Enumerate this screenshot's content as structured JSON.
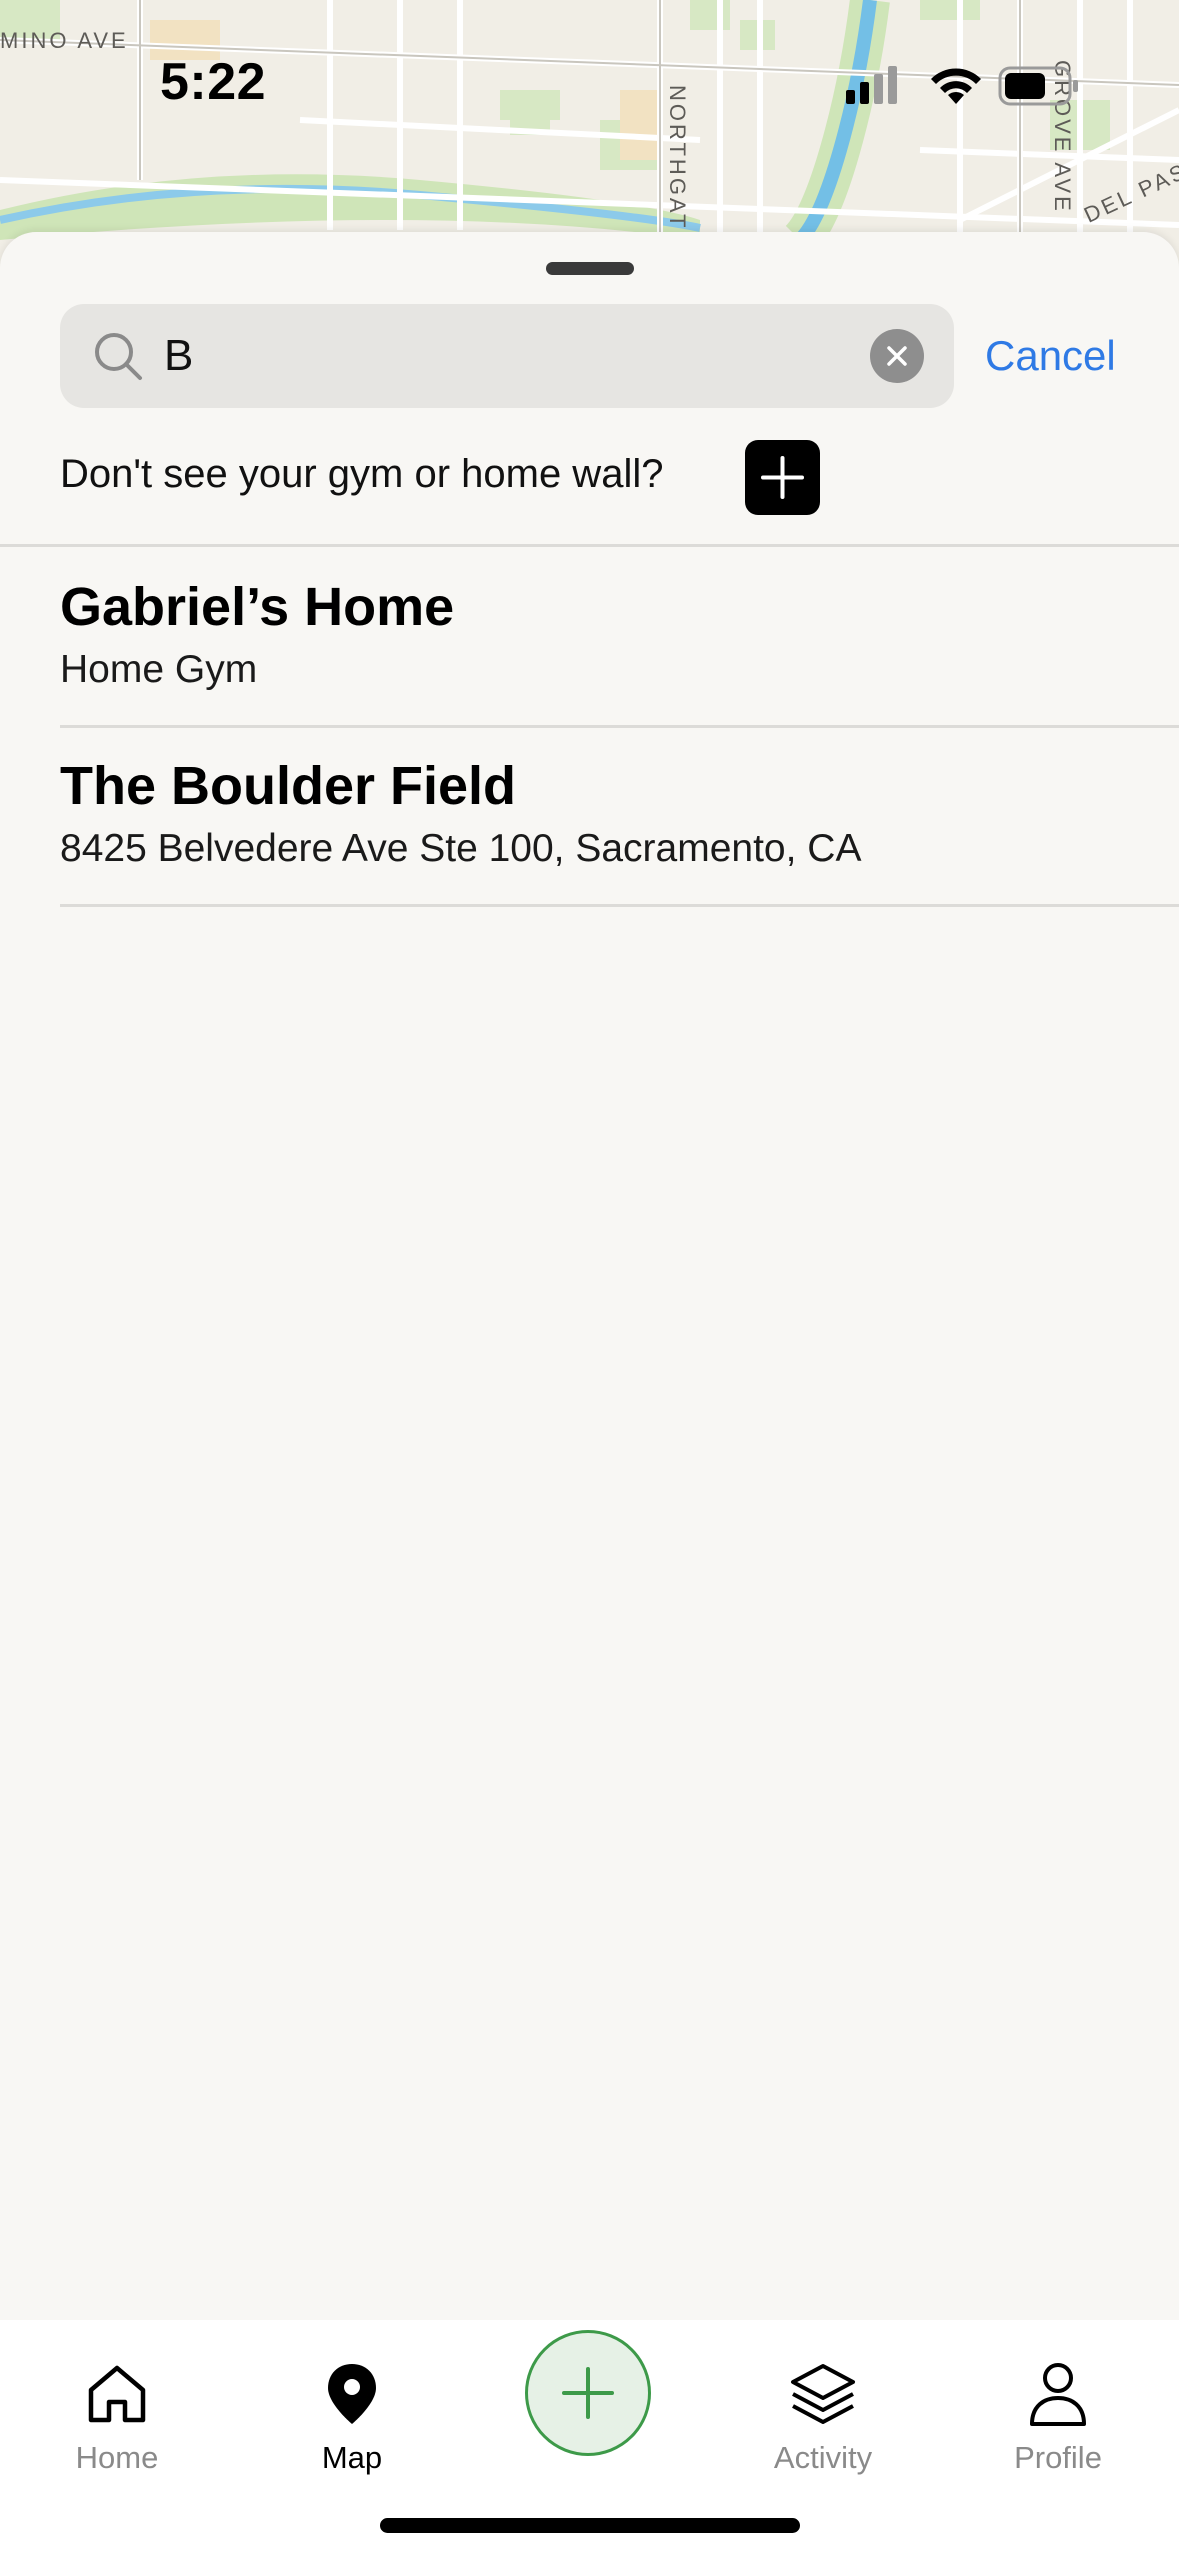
{
  "status_bar": {
    "time": "5:22"
  },
  "map": {
    "street_labels": [
      "MINO AVE",
      "NORTHGAT",
      "GROVE AVE",
      "DEL PAS"
    ]
  },
  "search": {
    "query": "B",
    "cancel_label": "Cancel"
  },
  "add_prompt": {
    "text": "Don't see your gym or home wall?"
  },
  "results": [
    {
      "title": "Gabriel’s Home",
      "subtitle": "Home Gym"
    },
    {
      "title": "The Boulder Field",
      "subtitle": "8425 Belvedere Ave Ste 100, Sacramento, CA"
    }
  ],
  "tabbar": {
    "tabs": [
      {
        "label": "Home",
        "icon": "home-icon"
      },
      {
        "label": "Map",
        "icon": "map-pin-icon",
        "active": true
      },
      {
        "label": "Activity",
        "icon": "layers-icon"
      },
      {
        "label": "Profile",
        "icon": "person-icon"
      }
    ],
    "fab_icon": "plus-icon"
  },
  "colors": {
    "accent_blue": "#2f7ae5",
    "fab_green": "#3d9a49",
    "fab_fill": "#e6f1e6",
    "sheet_bg": "#f8f7f4"
  }
}
